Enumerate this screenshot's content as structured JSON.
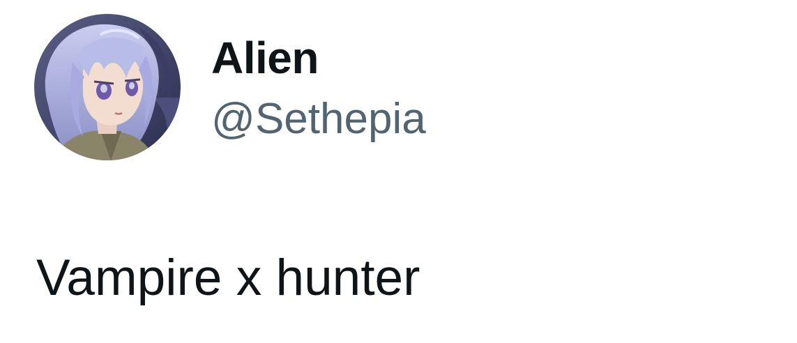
{
  "author": {
    "display_name": "Alien",
    "handle": "@Sethepia"
  },
  "tweet": {
    "text": "Vampire x hunter"
  },
  "colors": {
    "text_primary": "#0f1419",
    "text_secondary": "#536471",
    "background": "#ffffff"
  }
}
